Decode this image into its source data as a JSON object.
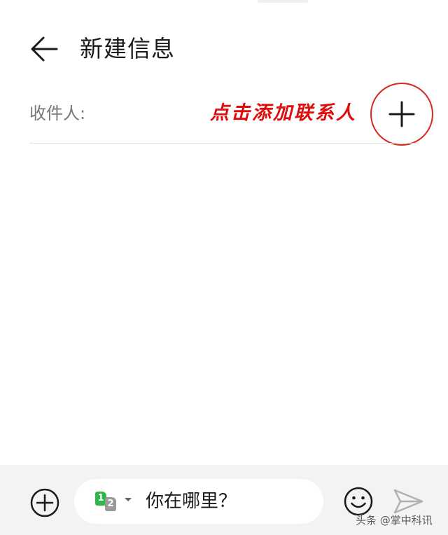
{
  "header": {
    "title": "新建信息",
    "back_icon": "arrow-left-icon"
  },
  "recipient": {
    "label": "收件人:",
    "add_icon": "plus-icon"
  },
  "annotation": {
    "text": "点击添加联系人",
    "color": "#e00b0b"
  },
  "composer": {
    "attach_icon": "plus-circle-icon",
    "sim_selector": {
      "sim1_label": "1",
      "sim2_label": "2",
      "sim1_color": "#2fb54a",
      "sim2_color": "#9a9a9a"
    },
    "message_text": "你在哪里？",
    "emoji_icon": "smiley-icon",
    "send_icon": "send-icon"
  },
  "watermark": {
    "text": "头条 @掌中科讯"
  }
}
